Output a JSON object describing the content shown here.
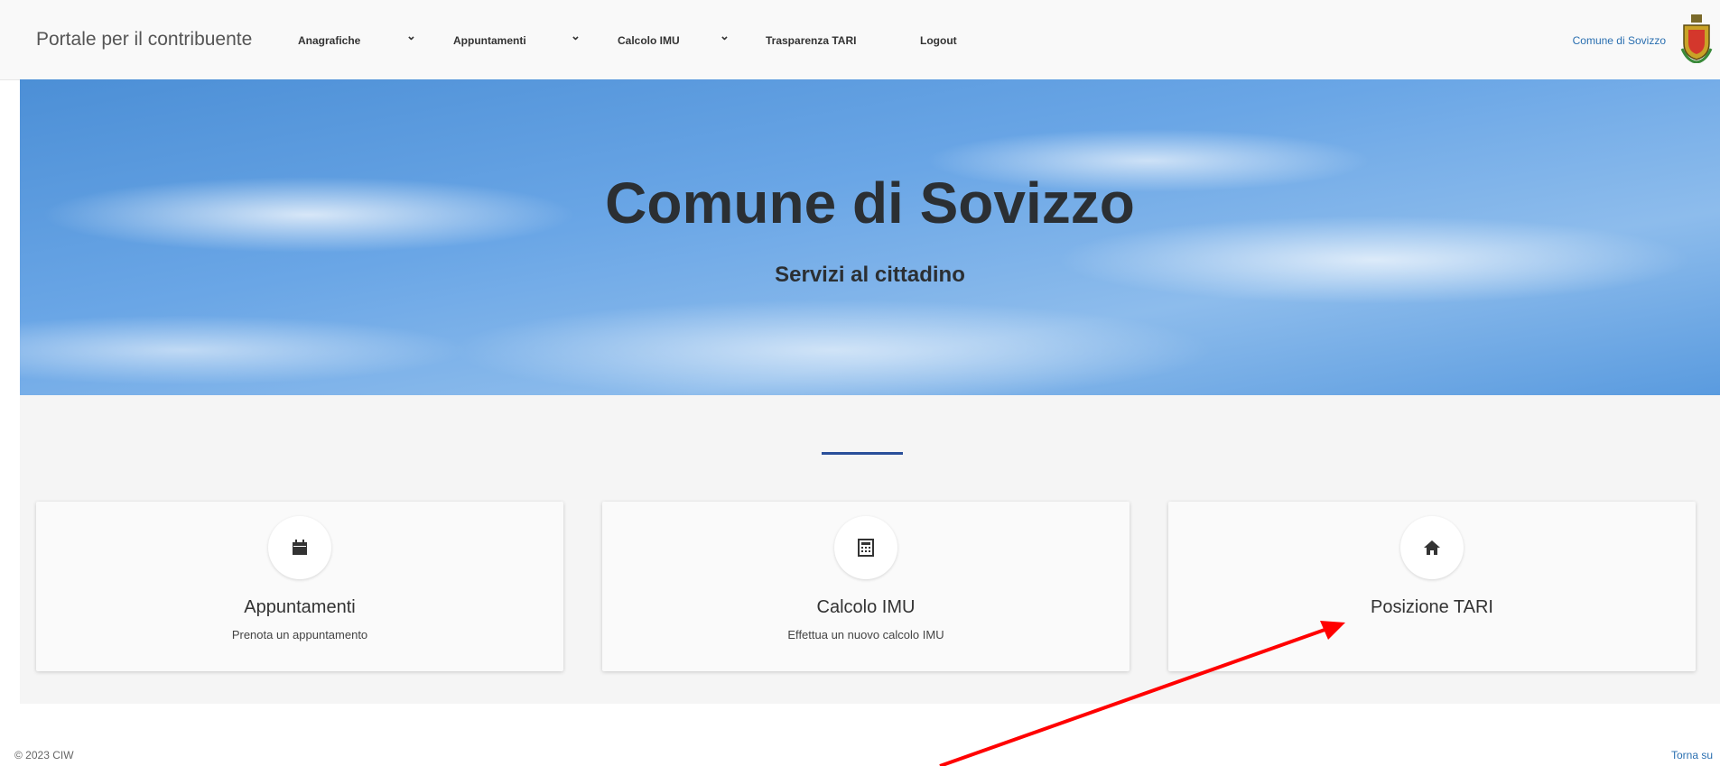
{
  "header": {
    "brand": "Portale per il contribuente",
    "nav": [
      {
        "label": "Anagrafiche"
      },
      {
        "label": "Appuntamenti"
      },
      {
        "label": "Calcolo IMU"
      },
      {
        "label": "Trasparenza TARI"
      },
      {
        "label": "Logout"
      }
    ],
    "municipality": "Comune di Sovizzo"
  },
  "hero": {
    "title": "Comune di Sovizzo",
    "subtitle": "Servizi al cittadino"
  },
  "cards": [
    {
      "title": "Appuntamenti",
      "description": "Prenota un appuntamento",
      "icon": "calendar-icon"
    },
    {
      "title": "Calcolo IMU",
      "description": "Effettua un nuovo calcolo IMU",
      "icon": "calculator-icon"
    },
    {
      "title": "Posizione TARI",
      "description": "",
      "icon": "home-icon"
    }
  ],
  "footer": {
    "copyright": "© 2023 CIW",
    "back_to_top": "Torna su"
  },
  "colors": {
    "accent": "#2a4f9a",
    "link": "#2a6fb0",
    "annotation_arrow": "#ff0000"
  }
}
